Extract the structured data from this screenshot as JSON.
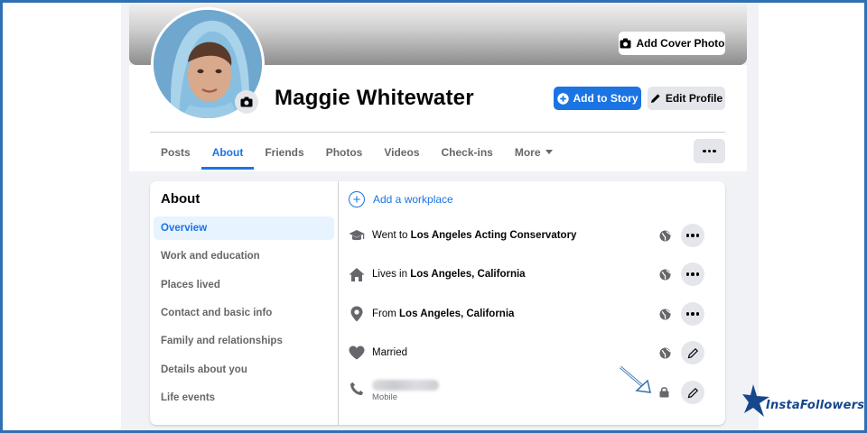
{
  "profile": {
    "name": "Maggie Whitewater",
    "add_cover_label": "Add Cover Photo",
    "add_story_label": "Add to Story",
    "edit_profile_label": "Edit Profile"
  },
  "tabs": [
    {
      "label": "Posts",
      "active": false
    },
    {
      "label": "About",
      "active": true
    },
    {
      "label": "Friends",
      "active": false
    },
    {
      "label": "Photos",
      "active": false
    },
    {
      "label": "Videos",
      "active": false
    },
    {
      "label": "Check-ins",
      "active": false
    },
    {
      "label": "More",
      "active": false
    }
  ],
  "about": {
    "title": "About",
    "sidebar": [
      {
        "label": "Overview",
        "active": true
      },
      {
        "label": "Work and education",
        "active": false
      },
      {
        "label": "Places lived",
        "active": false
      },
      {
        "label": "Contact and basic info",
        "active": false
      },
      {
        "label": "Family and relationships",
        "active": false
      },
      {
        "label": "Details about you",
        "active": false
      },
      {
        "label": "Life events",
        "active": false
      }
    ],
    "add_workplace": "Add a workplace",
    "rows": [
      {
        "prefix": "Went to ",
        "value": "Los Angeles Acting Conservatory",
        "icon": "graduation-cap-icon",
        "privacy": "globe-icon",
        "action": "more-options"
      },
      {
        "prefix": "Lives in ",
        "value": "Los Angeles, California",
        "icon": "home-icon",
        "privacy": "globe-icon",
        "action": "more-options"
      },
      {
        "prefix": "From ",
        "value": "Los Angeles, California",
        "icon": "location-pin-icon",
        "privacy": "globe-icon",
        "action": "more-options"
      },
      {
        "prefix": "Married",
        "value": "",
        "icon": "heart-icon",
        "privacy": "globe-icon",
        "action": "edit"
      }
    ],
    "phone": {
      "sub_label": "Mobile",
      "icon": "phone-icon",
      "privacy": "lock-icon",
      "action": "edit"
    }
  },
  "watermark": {
    "text": "InstaFollowers"
  },
  "colors": {
    "accent": "#1b74e4",
    "page_bg": "#f0f2f5",
    "border_frame": "#2f6fb3",
    "logo": "#16478c"
  }
}
